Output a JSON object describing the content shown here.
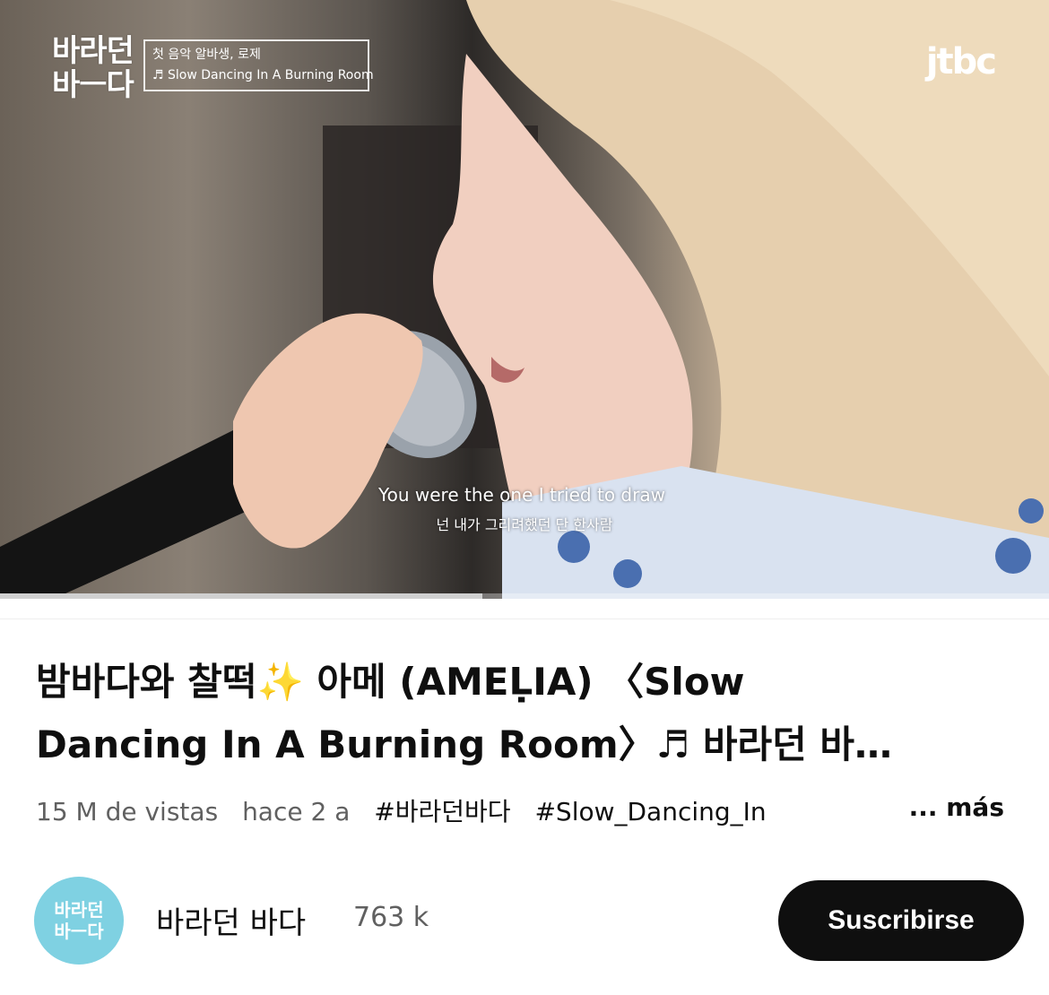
{
  "video": {
    "logo_line1": "바라던",
    "logo_line2": "바ㅡ다",
    "caption_line1": "첫 음악 알바생, 로제",
    "caption_line2": "♬ Slow Dancing In A Burning Room",
    "broadcaster": "jtbc",
    "subtitle_en": "You were the one I tried to draw",
    "subtitle_ko": "넌 내가 그리려했던 단 한사람",
    "progress_fraction": 0.46
  },
  "info": {
    "title_line1": "밤바다와 찰떡✨ 아메 (AMEḶIA) 〈Slow",
    "title_line2": "Dancing In A Burning Room〉♬ 바라던 바…",
    "views": "15 M de vistas",
    "age": "hace 2 a",
    "tag1": "#바라던바다",
    "tag2": "#Slow_Dancing_In",
    "more": "... más"
  },
  "channel": {
    "avatar_line1": "바라던",
    "avatar_line2": "바ㅡ다",
    "name": "바라던 바다",
    "subscribers": "763 k",
    "subscribe_label": "Suscribirse"
  },
  "colors": {
    "avatar": "#7fd1e2",
    "button": "#0f0f0f",
    "meta": "#606060"
  }
}
